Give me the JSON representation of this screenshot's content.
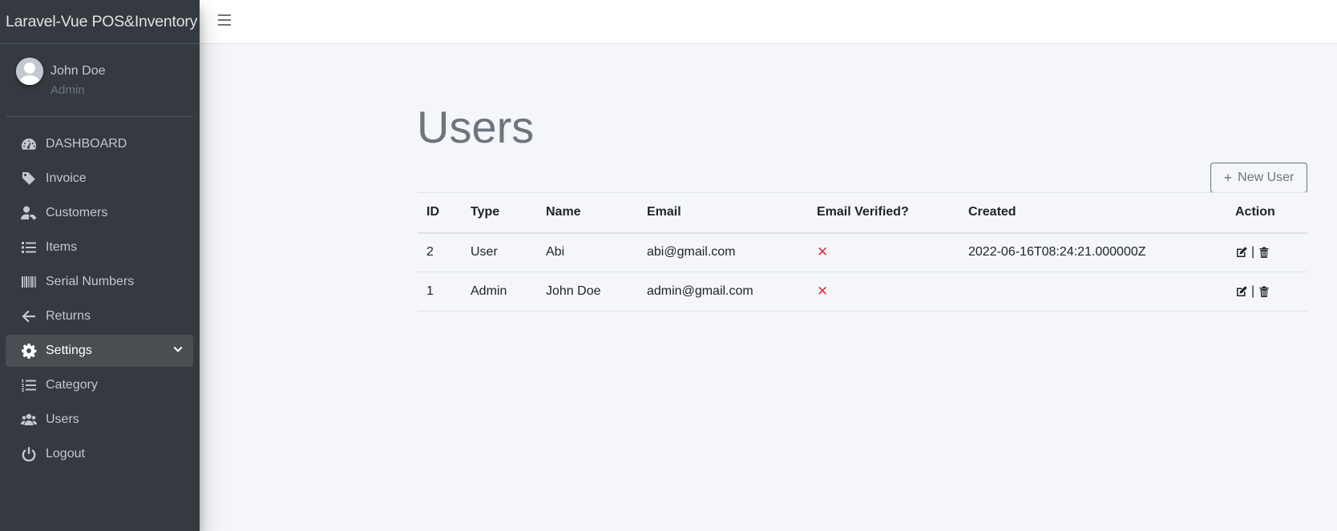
{
  "brand": "Laravel-Vue POS&Inventory",
  "user": {
    "name": "John Doe",
    "role": "Admin"
  },
  "nav": [
    {
      "label": "DASHBOARD",
      "icon": "dashboard-icon"
    },
    {
      "label": "Invoice",
      "icon": "tag-icon"
    },
    {
      "label": "Customers",
      "icon": "user-tag-icon"
    },
    {
      "label": "Items",
      "icon": "list-icon"
    },
    {
      "label": "Serial Numbers",
      "icon": "barcode-icon"
    },
    {
      "label": "Returns",
      "icon": "arrow-left-icon"
    },
    {
      "label": "Settings",
      "icon": "gear-icon",
      "active": true
    },
    {
      "label": "Category",
      "icon": "list-ol-icon"
    },
    {
      "label": "Users",
      "icon": "users-icon"
    },
    {
      "label": "Logout",
      "icon": "power-icon"
    }
  ],
  "page": {
    "title": "Users",
    "new_button": "New User"
  },
  "table": {
    "headers": [
      "ID",
      "Type",
      "Name",
      "Email",
      "Email Verified?",
      "Created",
      "Action"
    ],
    "rows": [
      {
        "id": "2",
        "type": "User",
        "name": "Abi",
        "email": "abi@gmail.com",
        "verified": "✕",
        "created": "2022-06-16T08:24:21.000000Z",
        "sep": "|"
      },
      {
        "id": "1",
        "type": "Admin",
        "name": "John Doe",
        "email": "admin@gmail.com",
        "verified": "✕",
        "created": "",
        "sep": "|"
      }
    ]
  },
  "colors": {
    "sidebar": "#343a40",
    "active_item": "#494e53",
    "background": "#f4f6f9",
    "danger": "#dc3545"
  }
}
